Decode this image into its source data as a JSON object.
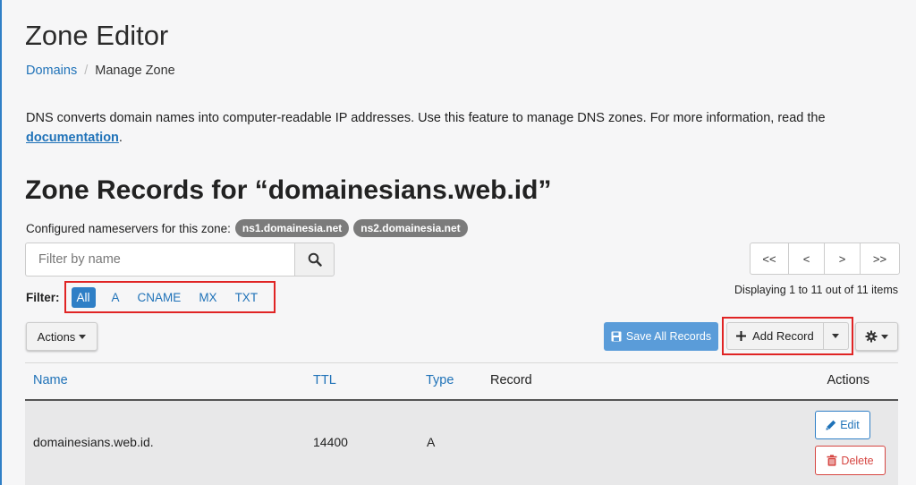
{
  "header": {
    "title": "Zone Editor",
    "breadcrumb": {
      "parent": "Domains",
      "separator": "/",
      "current": "Manage Zone"
    }
  },
  "description": {
    "text": "DNS converts domain names into computer-readable IP addresses. Use this feature to manage DNS zones. For more information, read the ",
    "link": "documentation",
    "suffix": "."
  },
  "zone": {
    "title": "Zone Records for “domainesians.web.id”",
    "ns_label": "Configured nameservers for this zone:",
    "nameservers": [
      "ns1.domainesia.net",
      "ns2.domainesia.net"
    ]
  },
  "filter": {
    "placeholder": "Filter by name",
    "label": "Filter:",
    "options": [
      "All",
      "A",
      "CNAME",
      "MX",
      "TXT"
    ],
    "active": "All"
  },
  "pagination": {
    "buttons": [
      "<<",
      "<",
      ">",
      ">>"
    ],
    "display_text": "Displaying 1 to 11 out of 11 items"
  },
  "toolbar": {
    "actions_label": "Actions",
    "save_label": "Save All Records",
    "add_label": "Add Record"
  },
  "table": {
    "headers": {
      "name": "Name",
      "ttl": "TTL",
      "type": "Type",
      "record": "Record",
      "actions": "Actions"
    },
    "rows": [
      {
        "name": "domainesians.web.id.",
        "ttl": "14400",
        "type": "A",
        "record": "",
        "edit_label": "Edit",
        "delete_label": "Delete"
      }
    ]
  },
  "colors": {
    "link": "#1f72b8",
    "primary": "#2f7fc6",
    "danger": "#d64541",
    "highlight_box": "#e02424",
    "badge": "#7b7b7b"
  },
  "icons": {
    "search": "search-icon",
    "save": "floppy-icon",
    "add": "plus-icon",
    "settings": "gear-icon",
    "edit": "pencil-icon",
    "delete": "trash-icon"
  }
}
